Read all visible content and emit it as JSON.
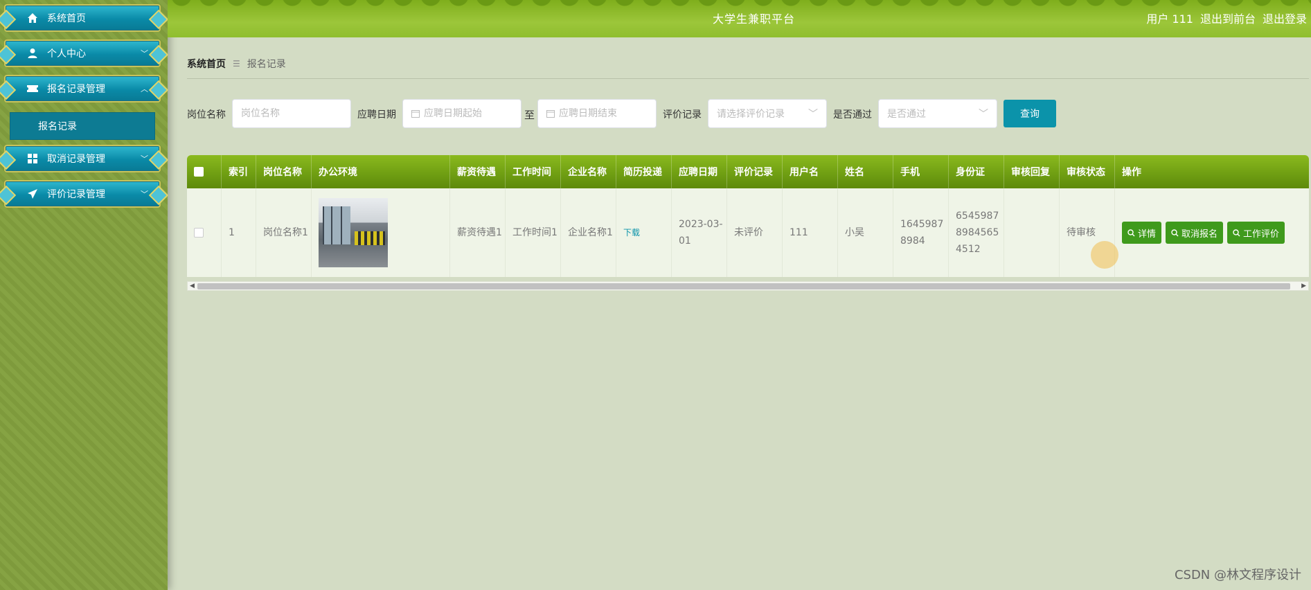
{
  "header": {
    "title": "大学生兼职平台",
    "user": "用户 111",
    "front_link": "退出到前台",
    "logout_link": "退出登录"
  },
  "sidebar": {
    "items": [
      {
        "label": "系统首页",
        "icon": "home-icon"
      },
      {
        "label": "个人中心",
        "icon": "user-icon"
      },
      {
        "label": "报名记录管理",
        "icon": "ticket-icon"
      },
      {
        "label": "取消记录管理",
        "icon": "grid-icon"
      },
      {
        "label": "评价记录管理",
        "icon": "send-icon"
      }
    ],
    "submenu": {
      "label": "报名记录"
    }
  },
  "breadcrumb": {
    "home": "系统首页",
    "current": "报名记录"
  },
  "search": {
    "job_label": "岗位名称",
    "job_placeholder": "岗位名称",
    "date_label": "应聘日期",
    "date_start_placeholder": "应聘日期起始",
    "date_to": "至",
    "date_end_placeholder": "应聘日期结束",
    "eval_label": "评价记录",
    "eval_placeholder": "请选择评价记录",
    "pass_label": "是否通过",
    "pass_placeholder": "是否通过",
    "query_button": "查询"
  },
  "table": {
    "headers": [
      "索引",
      "岗位名称",
      "办公环境",
      "薪资待遇",
      "工作时间",
      "企业名称",
      "简历投递",
      "应聘日期",
      "评价记录",
      "用户名",
      "姓名",
      "手机",
      "身份证",
      "审核回复",
      "审核状态",
      "操作"
    ],
    "row": {
      "index": "1",
      "job": "岗位名称1",
      "salary": "薪资待遇1",
      "work_time": "工作时间1",
      "company": "企业名称1",
      "resume": "下载",
      "date": "2023-03-01",
      "evaluation": "未评价",
      "username": "111",
      "name": "小吴",
      "phone": "16459878984",
      "id_card": "654598789845654512",
      "reply": "",
      "status": "待审核",
      "actions": {
        "detail": "详情",
        "cancel": "取消报名",
        "evaluate": "工作评价"
      }
    }
  },
  "watermark": "CSDN @林文程序设计",
  "colors": {
    "header": "#8fbe2e",
    "menu": "#0a8aa7",
    "table_head": "#6e9d12",
    "button": "#3f9a1c",
    "query": "#0b93aa"
  }
}
